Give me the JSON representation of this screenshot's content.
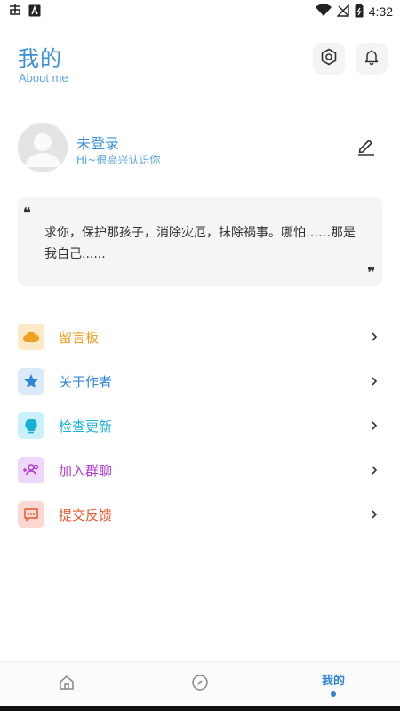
{
  "status_bar": {
    "time": "4:32",
    "icons": [
      "app-notification-icon",
      "a-icon",
      "wifi-icon",
      "no-signal-icon",
      "battery-icon"
    ]
  },
  "header": {
    "title": "我的",
    "subtitle": "About me",
    "settings_icon": "settings-hexagon-icon",
    "bell_icon": "bell-icon"
  },
  "profile": {
    "name": "未登录",
    "greeting": "Hi~很高兴认识你"
  },
  "quote": {
    "open_mark": "❝",
    "text": "求你，保护那孩子，消除灾厄，抹除祸事。哪怕……那是我自己......",
    "close_mark": "❞"
  },
  "menu": {
    "items": [
      {
        "label": "留言板",
        "color": "#f0a020",
        "bg": "#fde9c6",
        "icon": "cloud-icon"
      },
      {
        "label": "关于作者",
        "color": "#2e86d8",
        "bg": "#dbeafb",
        "icon": "star-icon"
      },
      {
        "label": "检查更新",
        "color": "#1ab0d6",
        "bg": "#c9f1fb",
        "icon": "bulb-icon"
      },
      {
        "label": "加入群聊",
        "color": "#b03ad6",
        "bg": "#eed7fa",
        "icon": "group-add-icon"
      },
      {
        "label": "提交反馈",
        "color": "#e8552a",
        "bg": "#fbd9d2",
        "icon": "feedback-icon"
      }
    ]
  },
  "bottom_nav": {
    "items": [
      {
        "icon": "home-icon"
      },
      {
        "icon": "compass-icon"
      },
      {
        "label": "我的",
        "active": true
      }
    ]
  },
  "colors": {
    "accent": "#2f86d6",
    "title": "#3a8fd8"
  }
}
